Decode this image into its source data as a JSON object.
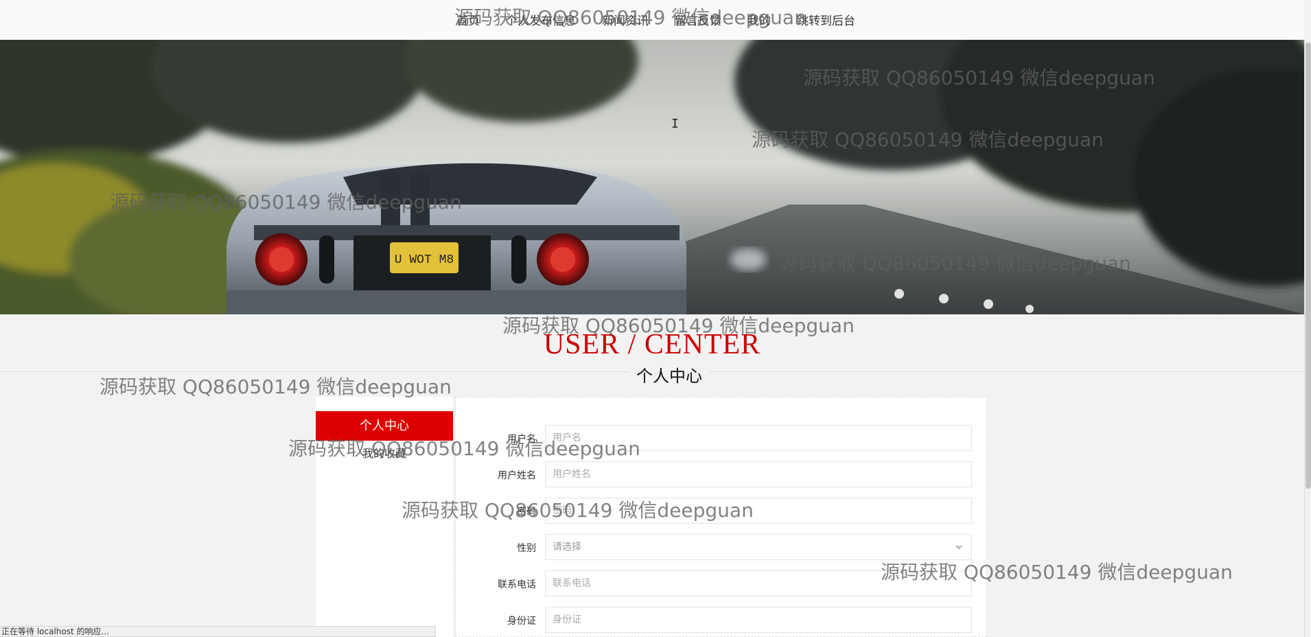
{
  "nav": {
    "items": [
      "首页",
      "个人发布信息",
      "新闻资讯",
      "留言反馈",
      "我的",
      "跳转到后台"
    ]
  },
  "section": {
    "title": "USER / CENTER",
    "subtitle": "个人中心"
  },
  "sidebar": {
    "active_label": "个人中心",
    "items": [
      "我的收藏"
    ]
  },
  "form": {
    "fields": [
      {
        "label": "用户名",
        "placeholder": "用户名",
        "type": "text"
      },
      {
        "label": "用户姓名",
        "placeholder": "用户姓名",
        "type": "text"
      },
      {
        "label": "密码",
        "placeholder": "密码",
        "type": "password"
      },
      {
        "label": "性别",
        "value": "请选择",
        "type": "select"
      },
      {
        "label": "联系电话",
        "placeholder": "联系电话",
        "type": "text"
      },
      {
        "label": "身份证",
        "placeholder": "身份证",
        "type": "text"
      }
    ]
  },
  "hero": {
    "plate_text": "U WOT M8"
  },
  "status_text": "正在等待 localhost 的响应...",
  "watermark_text": "源码获取 QQ86050149 微信deepguan",
  "colors": {
    "accent": "#d00000",
    "title": "#cc0000",
    "page_bg": "#f2f2f2"
  }
}
